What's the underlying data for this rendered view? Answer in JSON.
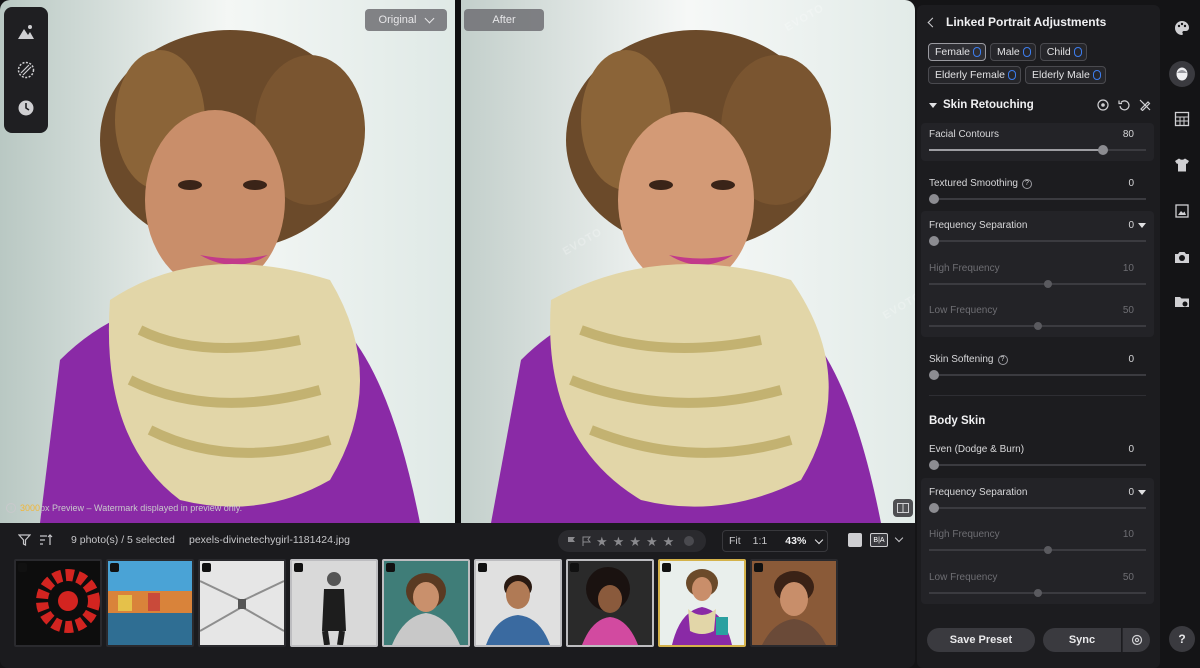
{
  "viewer": {
    "original_label": "Original",
    "after_label": "After",
    "preview_size": "3000",
    "preview_note": "px Preview – Watermark displayed in preview only.",
    "watermark": "EVOTO"
  },
  "filmstrip": {
    "photo_count": "9 photo(s) / 5 selected",
    "file_name": "pexels-divinetechygirl-1181424.jpg",
    "rating_stars": 5,
    "zoom_fit": "Fit",
    "zoom_one": "1:1",
    "zoom_value": "43%",
    "compare_mode": "B|A",
    "thumbnails": [
      {
        "name": "red-spiral",
        "selected": false,
        "current": false
      },
      {
        "name": "colorful-houses",
        "selected": false,
        "current": false
      },
      {
        "name": "white-corridor",
        "selected": false,
        "current": false
      },
      {
        "name": "man-in-suit",
        "selected": true,
        "current": false
      },
      {
        "name": "woman-scarf-smiling",
        "selected": true,
        "current": false
      },
      {
        "name": "man-smiling",
        "selected": true,
        "current": false
      },
      {
        "name": "woman-curly-hair",
        "selected": true,
        "current": false
      },
      {
        "name": "woman-purple-scarf",
        "selected": true,
        "current": true
      },
      {
        "name": "girl-portrait",
        "selected": false,
        "current": false
      }
    ]
  },
  "panel": {
    "title": "Linked Portrait Adjustments",
    "chips": [
      {
        "label": "Female",
        "active": true
      },
      {
        "label": "Male",
        "active": false
      },
      {
        "label": "Child",
        "active": false
      },
      {
        "label": "Elderly Female",
        "active": false
      },
      {
        "label": "Elderly Male",
        "active": false
      }
    ],
    "section_title": "Skin Retouching",
    "sliders": {
      "facial_contours": {
        "label": "Facial Contours",
        "value": "80",
        "level": 0.8
      },
      "textured_smoothing": {
        "label": "Textured Smoothing",
        "value": "0",
        "level": 0
      },
      "freq_sep_1": {
        "label": "Frequency Separation",
        "value": "0",
        "level": 0
      },
      "high_freq_1": {
        "label": "High Frequency",
        "value": "10",
        "level": 0.55
      },
      "low_freq_1": {
        "label": "Low Frequency",
        "value": "50",
        "level": 0.5
      },
      "skin_softening": {
        "label": "Skin Softening",
        "value": "0",
        "level": 0
      },
      "even_dodge_burn": {
        "label": "Even (Dodge & Burn)",
        "value": "0",
        "level": 0
      },
      "freq_sep_2": {
        "label": "Frequency Separation",
        "value": "0",
        "level": 0
      },
      "high_freq_2": {
        "label": "High Frequency",
        "value": "10",
        "level": 0.55
      },
      "low_freq_2": {
        "label": "Low Frequency",
        "value": "50",
        "level": 0.5
      }
    },
    "body_skin_title": "Body Skin",
    "save_preset": "Save Preset",
    "sync": "Sync"
  },
  "icons": {
    "rail": [
      "palette-icon",
      "face-icon",
      "grid-icon",
      "shirt-icon",
      "crop-image-icon",
      "camera-icon",
      "folder-sync-icon",
      "help-icon"
    ]
  }
}
